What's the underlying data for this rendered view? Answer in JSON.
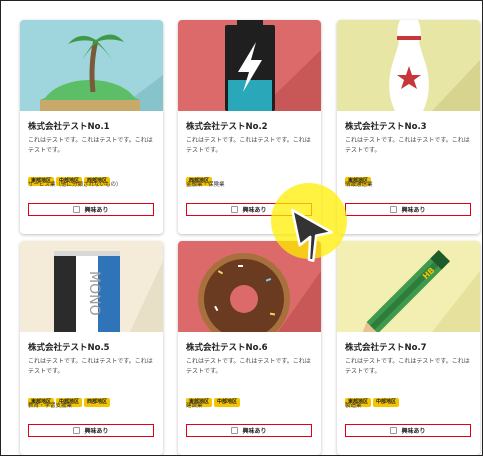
{
  "cards": [
    {
      "title": "株式会社テストNo.1",
      "desc": "これはテストです。これはテストです。これはテストです。",
      "tags": [
        "東部地区",
        "中部地区",
        "西部地区"
      ],
      "industry": "サービス業（他に分類されないもの）",
      "button": "興味あり"
    },
    {
      "title": "株式会社テストNo.2",
      "desc": "これはテストです。これはテストです。これはテストです。",
      "tags": [
        "西部地区"
      ],
      "industry": "金融業・保険業",
      "button": "興味あり"
    },
    {
      "title": "株式会社テストNo.3",
      "desc": "これはテストです。これはテストです。これはテストです。",
      "tags": [
        "東部地区"
      ],
      "industry": "情報通信業",
      "button": "興味あり"
    },
    {
      "title": "株式会社テストNo.5",
      "desc": "これはテストです。これはテストです。これはテストです。",
      "tags": [
        "東部地区",
        "中部地区",
        "西部地区"
      ],
      "industry": "教育・学習支援業",
      "button": "興味あり"
    },
    {
      "title": "株式会社テストNo.6",
      "desc": "これはテストです。これはテストです。これはテストです。",
      "tags": [
        "東部地区",
        "中部地区"
      ],
      "industry": "建設業",
      "button": "興味あり"
    },
    {
      "title": "株式会社テストNo.7",
      "desc": "これはテストです。これはテストです。これはテストです。",
      "tags": [
        "東部地区",
        "中部地区"
      ],
      "industry": "製造業",
      "button": "興味あり"
    }
  ],
  "images": {
    "card1": {
      "label": "palm-island",
      "bg": "#9fd6dd"
    },
    "card2": {
      "label": "battery-bolt",
      "bg": "#dc6a6a"
    },
    "card3": {
      "label": "bowling-pin",
      "bg": "#e8e6a5"
    },
    "card5": {
      "label": "eraser",
      "bg": "#f4ecd9",
      "text": "MONO"
    },
    "card6": {
      "label": "donut",
      "bg": "#dc6a6a"
    },
    "card7": {
      "label": "pencil",
      "bg": "#f3efb3",
      "text": "HB"
    }
  },
  "colors": {
    "tag": "#f5c400",
    "button_border": "#e0001b",
    "cursor_highlight": "#ffee00"
  }
}
